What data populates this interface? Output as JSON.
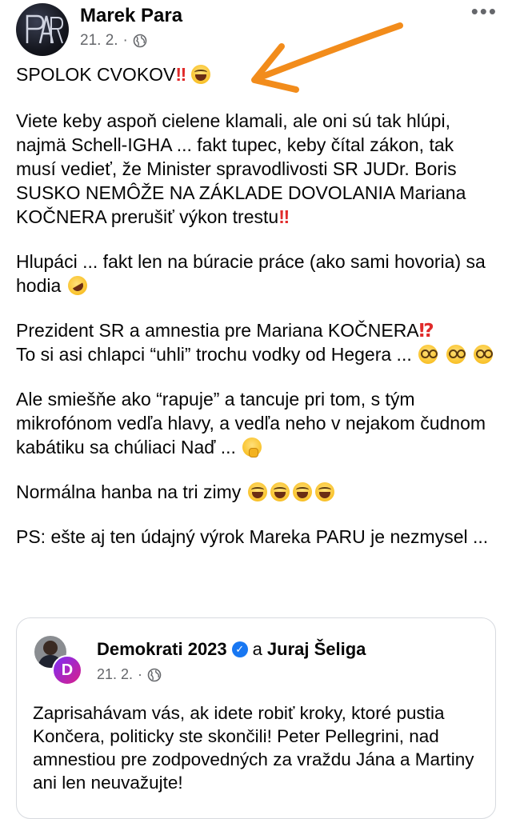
{
  "post": {
    "author": "Marek Para",
    "date": "21. 2.",
    "separator": "·",
    "audience_icon": "globe-icon",
    "more_label": "•••",
    "p1": "SPOLOK CVOKOV",
    "p2a": "Viete keby aspoň cielene klamali, ale oni sú tak hlúpi, najmä Schell-IGHA ... fakt tupec, keby čítal zákon, tak musí vedieť, že Minister spravodlivosti SR JUDr. Boris SUSKO NEMÔŽE NA ZÁKLADE DOVOLANIA Mariana KOČNERA prerušiť výkon trestu",
    "p3": "Hlupáci ... fakt len na búracie práce (ako sami hovoria) sa hodia",
    "p4a": "Prezident SR a amnestia pre Mariana KOČNERA",
    "p4b": "To si asi chlapci “uhli” trochu vodky od Hegera ...",
    "p5": "Ale smiešňe ako “rapuje” a tancuje pri tom, s tým mikrofónom vedľa hlavy, a vedľa neho v nejakom čudnom kabátiku sa chúliaci Naď ...",
    "p6": "Normálna hanba na tri zimy",
    "p7": "PS: ešte aj ten údajný výrok Mareka PARU je nezmysel ...",
    "bang_double": "‼",
    "bang_question": "⁉",
    "accent_color": "#f28c1b"
  },
  "shared_post": {
    "page_name": "Demokrati 2023",
    "conjunction": "a",
    "coauthor": "Juraj Šeliga",
    "verified_mark": "✓",
    "logo_letter": "D",
    "date": "21. 2.",
    "separator": "·",
    "text": "Zaprisahávam vás, ak idete robiť kroky, ktoré pustia Končera, politicky ste skončili! Peter Pellegrini, nad amnestiou pre zodpovedných za vraždu Jána a Martiny ani len neuvažujte!"
  }
}
